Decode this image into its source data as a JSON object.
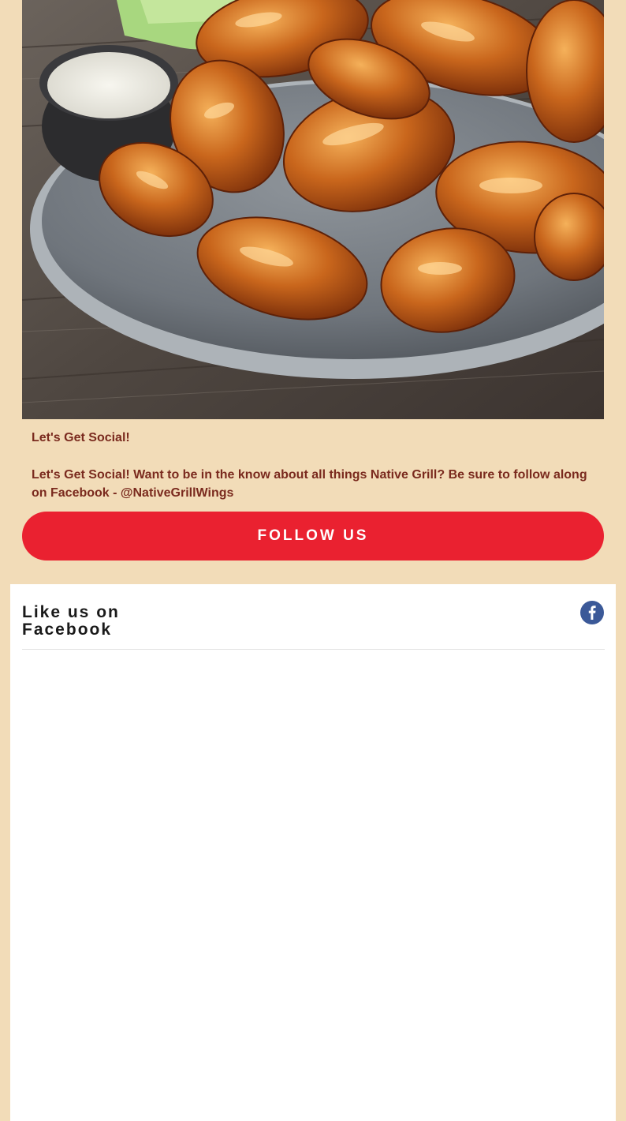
{
  "hero": {
    "image_description": "Plate of glazed chicken wings with ranch dip and celery"
  },
  "social": {
    "heading": "Let's Get Social!",
    "body": "Let's Get Social! Want to be in the know about all things Native Grill? Be sure to follow along on Facebook - @NativeGrillWings",
    "button_label": "FOLLOW US",
    "button_color": "#ea2130",
    "text_color": "#7a2a1e",
    "page_background": "#f2dcb8"
  },
  "facebook_widget": {
    "title": "Like us on Facebook",
    "icon": "facebook-icon",
    "icon_color": "#3b5998"
  }
}
